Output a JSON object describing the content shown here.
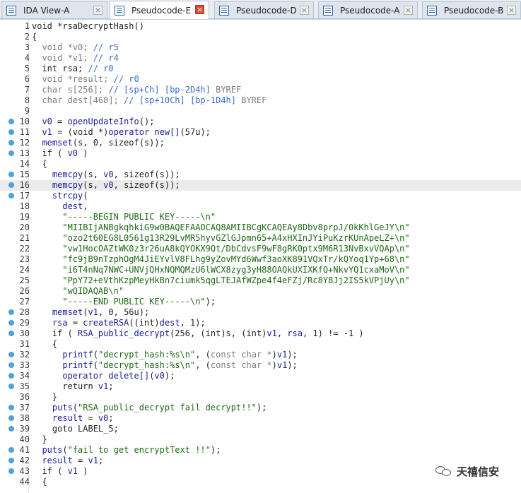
{
  "tabs": [
    {
      "label": "IDA View-A",
      "active": false
    },
    {
      "label": "Pseudocode-E",
      "active": true
    },
    {
      "label": "Pseudocode-D",
      "active": false
    },
    {
      "label": "Pseudocode-A",
      "active": false
    },
    {
      "label": "Pseudocode-B",
      "active": false
    }
  ],
  "close_glyph": "×",
  "watermark": "天禧信安",
  "lines": [
    {
      "n": "1",
      "bp": false,
      "hl": false,
      "t": [
        [
          "p",
          "void *rsaDecryptHash()"
        ]
      ]
    },
    {
      "n": "2",
      "bp": false,
      "hl": false,
      "t": [
        [
          "p",
          "{"
        ]
      ]
    },
    {
      "n": "3",
      "bp": false,
      "hl": false,
      "t": [
        [
          "g",
          "  void *v0; "
        ],
        [
          "c",
          "// r5"
        ]
      ]
    },
    {
      "n": "4",
      "bp": false,
      "hl": false,
      "t": [
        [
          "g",
          "  void *v1; "
        ],
        [
          "c",
          "// r4"
        ]
      ]
    },
    {
      "n": "5",
      "bp": false,
      "hl": false,
      "t": [
        [
          "p",
          "  int rsa; "
        ],
        [
          "c",
          "// r0"
        ]
      ]
    },
    {
      "n": "6",
      "bp": false,
      "hl": false,
      "t": [
        [
          "g",
          "  void *result; "
        ],
        [
          "c",
          "// r0"
        ]
      ]
    },
    {
      "n": "7",
      "bp": false,
      "hl": false,
      "t": [
        [
          "g",
          "  char s[256]; "
        ],
        [
          "c",
          "// [sp+Ch] [bp-2D4h] "
        ],
        [
          "g",
          "BYREF"
        ]
      ]
    },
    {
      "n": "8",
      "bp": false,
      "hl": false,
      "t": [
        [
          "g",
          "  char dest[468]; "
        ],
        [
          "c",
          "// [sp+10Ch] [bp-1D4h] "
        ],
        [
          "g",
          "BYREF"
        ]
      ]
    },
    {
      "n": "9",
      "bp": false,
      "hl": false,
      "t": [
        [
          "p",
          ""
        ]
      ]
    },
    {
      "n": "10",
      "bp": true,
      "hl": false,
      "t": [
        [
          "p",
          "  "
        ],
        [
          "v",
          "v0"
        ],
        [
          "p",
          " = "
        ],
        [
          "k",
          "openUpdateInfo"
        ],
        [
          "p",
          "();"
        ]
      ]
    },
    {
      "n": "11",
      "bp": true,
      "hl": false,
      "t": [
        [
          "p",
          "  "
        ],
        [
          "v",
          "v1"
        ],
        [
          "p",
          " = (void *)"
        ],
        [
          "k",
          "operator new[]"
        ],
        [
          "p",
          "(57u);"
        ]
      ]
    },
    {
      "n": "12",
      "bp": true,
      "hl": false,
      "t": [
        [
          "p",
          "  "
        ],
        [
          "k",
          "memset"
        ],
        [
          "p",
          "(s, 0, sizeof(s));"
        ]
      ]
    },
    {
      "n": "13",
      "bp": true,
      "hl": false,
      "t": [
        [
          "p",
          "  if ( "
        ],
        [
          "v",
          "v0"
        ],
        [
          "p",
          " )"
        ]
      ]
    },
    {
      "n": "14",
      "bp": false,
      "hl": false,
      "t": [
        [
          "p",
          "  {"
        ]
      ]
    },
    {
      "n": "15",
      "bp": true,
      "hl": false,
      "t": [
        [
          "p",
          "    "
        ],
        [
          "k",
          "memcpy"
        ],
        [
          "p",
          "(s, "
        ],
        [
          "v",
          "v0"
        ],
        [
          "p",
          ", sizeof(s));"
        ]
      ]
    },
    {
      "n": "16",
      "bp": true,
      "hl": true,
      "t": [
        [
          "p",
          "    "
        ],
        [
          "k",
          "memcpy"
        ],
        [
          "p",
          "(s, "
        ],
        [
          "v",
          "v0"
        ],
        [
          "p",
          ", sizeof(s));"
        ]
      ]
    },
    {
      "n": "17",
      "bp": true,
      "hl": false,
      "t": [
        [
          "p",
          "    "
        ],
        [
          "k",
          "strcpy"
        ],
        [
          "p",
          "("
        ]
      ]
    },
    {
      "n": "18",
      "bp": false,
      "hl": false,
      "t": [
        [
          "p",
          "      "
        ],
        [
          "v",
          "dest"
        ],
        [
          "p",
          ","
        ]
      ]
    },
    {
      "n": "19",
      "bp": false,
      "hl": false,
      "t": [
        [
          "p",
          "      "
        ],
        [
          "s",
          "\"-----BEGIN PUBLIC KEY-----\\n\""
        ]
      ]
    },
    {
      "n": "20",
      "bp": false,
      "hl": false,
      "t": [
        [
          "p",
          "      "
        ],
        [
          "s",
          "\"MIIBIjANBgkqhkiG9w0BAQEFAAOCAQ8AMIIBCgKCAQEAy8Dbv8prpJ/0kKhlGeJY\\n\""
        ]
      ]
    },
    {
      "n": "21",
      "bp": false,
      "hl": false,
      "t": [
        [
          "p",
          "      "
        ],
        [
          "s",
          "\"ozo2t60EG8L0561g13R29LvMR5hyvGZlGJpmn65+A4xHXInJYiPuKzrKUnApeLZ+\\n\""
        ]
      ]
    },
    {
      "n": "22",
      "bp": false,
      "hl": false,
      "t": [
        [
          "p",
          "      "
        ],
        [
          "s",
          "\"vw1HocOAZtWK0z3r26uA8kQYOKX9Qt/DbCdvsF9wF8gRK0ptx9M6R13NvBxvVQAp\\n\""
        ]
      ]
    },
    {
      "n": "23",
      "bp": false,
      "hl": false,
      "t": [
        [
          "p",
          "      "
        ],
        [
          "s",
          "\"fc9jB9nTzphOgM4JiEYvlV8FLhg9yZovMYd6Wwf3aoXK891VQxTr/kQYoq1Yp+68\\n\""
        ]
      ]
    },
    {
      "n": "24",
      "bp": false,
      "hl": false,
      "t": [
        [
          "p",
          "      "
        ],
        [
          "s",
          "\"i6T4nNq7NWC+UNVjQHxNQMQMzU6lWCX8zyg3yH88OAQkUXIXKfQ+NkvYQ1cxaMoV\\n\""
        ]
      ]
    },
    {
      "n": "25",
      "bp": false,
      "hl": false,
      "t": [
        [
          "p",
          "      "
        ],
        [
          "s",
          "\"PpY72+eVthKzpMeyHkBn7ciumk5qgLTEJAfWZpe4f4eFZj/Rc8Y8Jj2IS5kVPjUy\\n\""
        ]
      ]
    },
    {
      "n": "26",
      "bp": false,
      "hl": false,
      "t": [
        [
          "p",
          "      "
        ],
        [
          "s",
          "\"wQIDAQAB\\n\""
        ]
      ]
    },
    {
      "n": "27",
      "bp": false,
      "hl": false,
      "t": [
        [
          "p",
          "      "
        ],
        [
          "s",
          "\"-----END PUBLIC KEY-----\\n\""
        ],
        [
          "p",
          ");"
        ]
      ]
    },
    {
      "n": "28",
      "bp": true,
      "hl": false,
      "t": [
        [
          "p",
          "    "
        ],
        [
          "k",
          "memset"
        ],
        [
          "p",
          "("
        ],
        [
          "v",
          "v1"
        ],
        [
          "p",
          ", 0, 56u);"
        ]
      ]
    },
    {
      "n": "29",
      "bp": true,
      "hl": false,
      "t": [
        [
          "p",
          "    "
        ],
        [
          "v",
          "rsa"
        ],
        [
          "p",
          " = "
        ],
        [
          "k",
          "createRSA"
        ],
        [
          "p",
          "((int)"
        ],
        [
          "v",
          "dest"
        ],
        [
          "p",
          ", 1);"
        ]
      ]
    },
    {
      "n": "30",
      "bp": true,
      "hl": false,
      "t": [
        [
          "p",
          "    if ( "
        ],
        [
          "k",
          "RSA_public_decrypt"
        ],
        [
          "p",
          "(256, (int)s, (int)"
        ],
        [
          "v",
          "v1"
        ],
        [
          "p",
          ", "
        ],
        [
          "v",
          "rsa"
        ],
        [
          "p",
          ", 1) != -1 )"
        ]
      ]
    },
    {
      "n": "31",
      "bp": false,
      "hl": false,
      "t": [
        [
          "p",
          "    {"
        ]
      ]
    },
    {
      "n": "32",
      "bp": true,
      "hl": false,
      "t": [
        [
          "p",
          "      "
        ],
        [
          "k",
          "printf"
        ],
        [
          "p",
          "("
        ],
        [
          "s",
          "\"decrypt_hash:%s\\n\""
        ],
        [
          "p",
          ", ("
        ],
        [
          "g",
          "const char *"
        ],
        [
          "p",
          ")"
        ],
        [
          "v",
          "v1"
        ],
        [
          "p",
          ");"
        ]
      ]
    },
    {
      "n": "33",
      "bp": true,
      "hl": false,
      "t": [
        [
          "p",
          "      "
        ],
        [
          "k",
          "printf"
        ],
        [
          "p",
          "("
        ],
        [
          "s",
          "\"decrypt_hash:%s\\n\""
        ],
        [
          "p",
          ", ("
        ],
        [
          "g",
          "const char *"
        ],
        [
          "p",
          ")"
        ],
        [
          "v",
          "v1"
        ],
        [
          "p",
          ");"
        ]
      ]
    },
    {
      "n": "34",
      "bp": true,
      "hl": false,
      "t": [
        [
          "p",
          "      "
        ],
        [
          "k",
          "operator delete[]"
        ],
        [
          "p",
          "("
        ],
        [
          "v",
          "v0"
        ],
        [
          "p",
          ");"
        ]
      ]
    },
    {
      "n": "35",
      "bp": true,
      "hl": false,
      "t": [
        [
          "p",
          "      return "
        ],
        [
          "v",
          "v1"
        ],
        [
          "p",
          ";"
        ]
      ]
    },
    {
      "n": "36",
      "bp": false,
      "hl": false,
      "t": [
        [
          "p",
          "    }"
        ]
      ]
    },
    {
      "n": "37",
      "bp": true,
      "hl": false,
      "t": [
        [
          "p",
          "    "
        ],
        [
          "k",
          "puts"
        ],
        [
          "p",
          "("
        ],
        [
          "s",
          "\"RSA_public_decrypt fail decrypt!!\""
        ],
        [
          "p",
          ");"
        ]
      ]
    },
    {
      "n": "38",
      "bp": true,
      "hl": false,
      "t": [
        [
          "p",
          "    "
        ],
        [
          "v",
          "result"
        ],
        [
          "p",
          " = "
        ],
        [
          "v",
          "v0"
        ],
        [
          "p",
          ";"
        ]
      ]
    },
    {
      "n": "39",
      "bp": true,
      "hl": false,
      "t": [
        [
          "p",
          "    goto LABEL_5;"
        ]
      ]
    },
    {
      "n": "40",
      "bp": false,
      "hl": false,
      "t": [
        [
          "p",
          "  }"
        ]
      ]
    },
    {
      "n": "41",
      "bp": true,
      "hl": false,
      "t": [
        [
          "p",
          "  "
        ],
        [
          "k",
          "puts"
        ],
        [
          "p",
          "("
        ],
        [
          "s",
          "\"fail to get encryptText !!\""
        ],
        [
          "p",
          ");"
        ]
      ]
    },
    {
      "n": "42",
      "bp": true,
      "hl": false,
      "t": [
        [
          "p",
          "  "
        ],
        [
          "v",
          "result"
        ],
        [
          "p",
          " = "
        ],
        [
          "v",
          "v1"
        ],
        [
          "p",
          ";"
        ]
      ]
    },
    {
      "n": "43",
      "bp": true,
      "hl": false,
      "t": [
        [
          "p",
          "  if ( "
        ],
        [
          "v",
          "v1"
        ],
        [
          "p",
          " )"
        ]
      ]
    },
    {
      "n": "44",
      "bp": false,
      "hl": false,
      "t": [
        [
          "p",
          "  {"
        ]
      ]
    }
  ]
}
